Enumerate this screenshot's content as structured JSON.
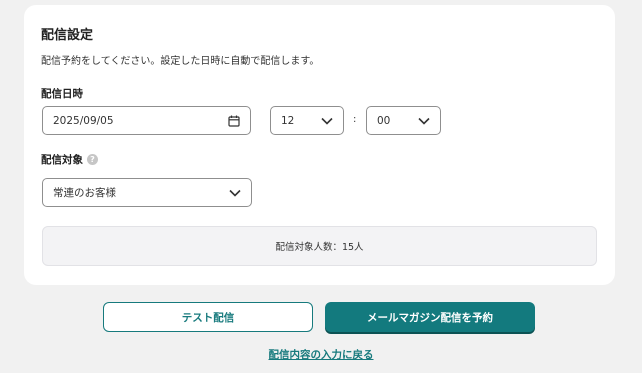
{
  "settings": {
    "title": "配信設定",
    "description": "配信予約をしてください。設定した日時に自動で配信します。",
    "datetime_label": "配信日時",
    "date_value": "2025/09/05",
    "hour_value": "12",
    "time_separator": ":",
    "minute_value": "00",
    "target_label": "配信対象",
    "target_value": "常連のお客様",
    "target_count": "配信対象人数：15人"
  },
  "actions": {
    "test_label": "テスト配信",
    "schedule_label": "メールマガジン配信を予約",
    "back_label": "配信内容の入力に戻る"
  },
  "colors": {
    "accent": "#137a7e",
    "background": "#f1f1f1",
    "card": "#ffffff"
  },
  "icons": {
    "date": "calendar-icon",
    "select": "chevron-down-icon",
    "help": "help-icon"
  }
}
